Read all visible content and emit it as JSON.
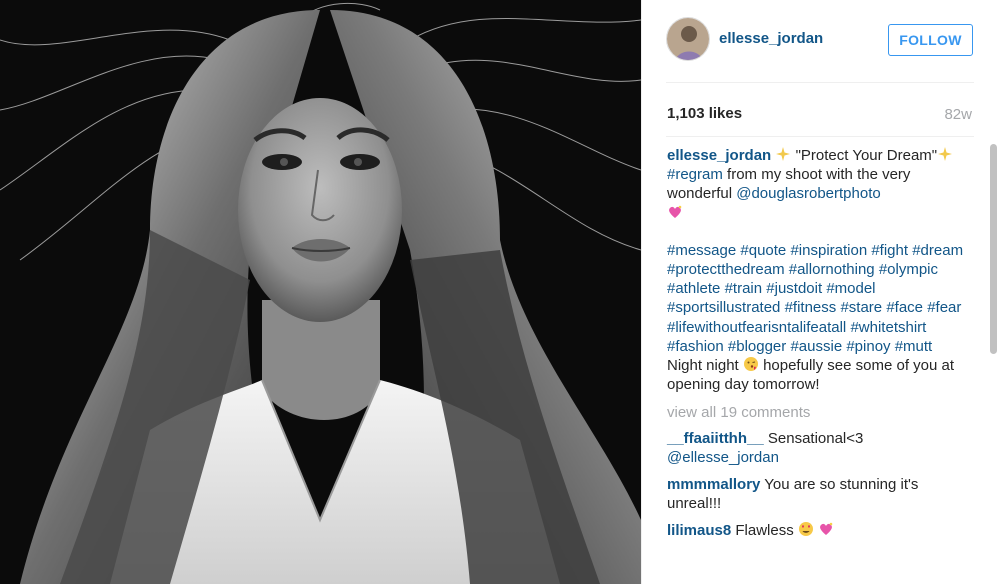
{
  "post": {
    "username": "ellesse_jordan",
    "follow_label": "FOLLOW",
    "likes": "1,103 likes",
    "age": "82w"
  },
  "caption": {
    "username": "ellesse_jordan",
    "quote": "\"Protect Your Dream\"",
    "regram_tag": "#regram",
    "text_a": "from my shoot with the very wonderful",
    "mention": "@douglasrobertphoto",
    "hashtags": [
      "#message",
      "#quote",
      "#inspiration",
      "#fight",
      "#dream",
      "#protectthedream",
      "#allornothing",
      "#olympic",
      "#athlete",
      "#train",
      "#justdoit",
      "#model",
      "#sportsillustrated",
      "#fitness",
      "#stare",
      "#face",
      "#fear",
      "#lifewithoutfearisntalifeatall",
      "#whitetshirt",
      "#fashion",
      "#blogger",
      "#aussie",
      "#pinoy",
      "#mutt"
    ],
    "night_a": "Night night",
    "night_b": "hopefully see some of you at opening day tomorrow!"
  },
  "view_all_label": "view all 19 comments",
  "comments": [
    {
      "user": "__ffaaiitthh__",
      "text": "Sensational<3",
      "mention": "@ellesse_jordan"
    },
    {
      "user": "mmmmallory",
      "text": "You are so stunning it's unreal!!!"
    },
    {
      "user": "lilimaus8",
      "text": "Flawless"
    }
  ],
  "icons": {
    "sparkle": "sparkles-icon",
    "heart": "sparkling-heart-icon",
    "kiss": "kissing-face-icon",
    "heart_eyes": "heart-eyes-icon"
  },
  "colors": {
    "link": "#125688",
    "follow": "#3897f0",
    "muted": "#a5a7aa"
  }
}
